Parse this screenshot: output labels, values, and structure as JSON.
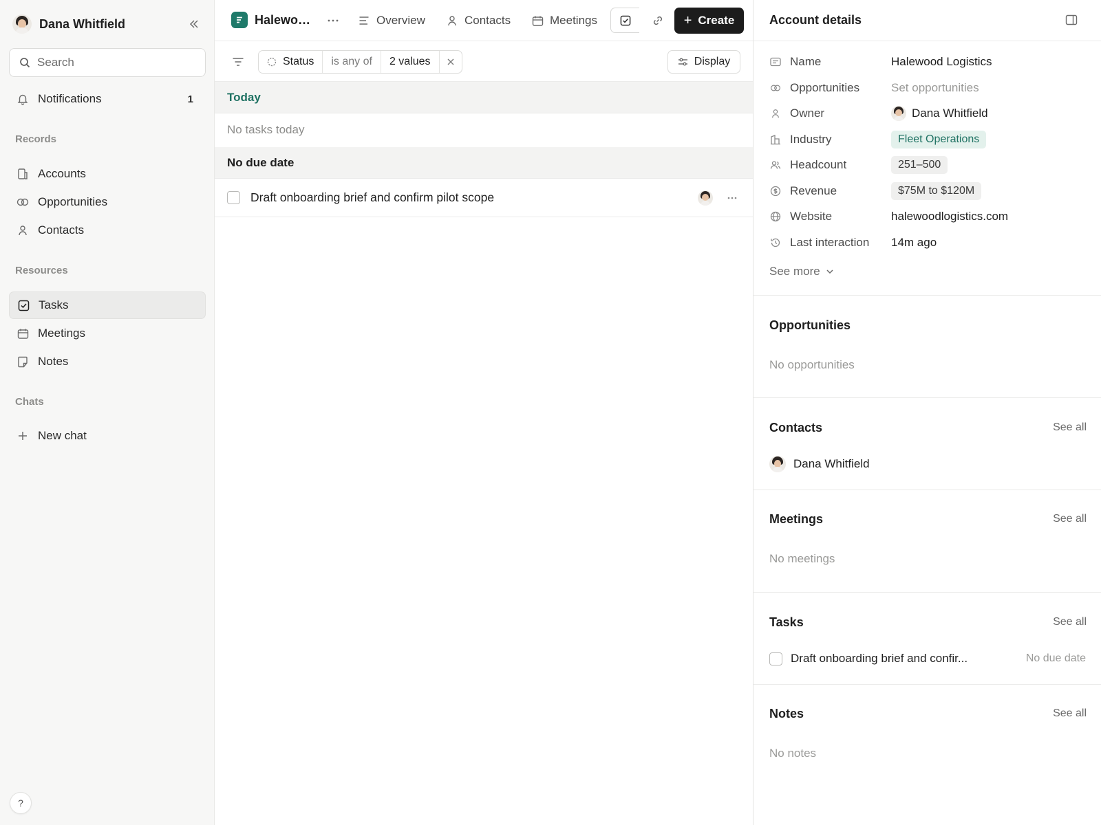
{
  "sidebar": {
    "user_name": "Dana Whitfield",
    "search_placeholder": "Search",
    "notifications": {
      "label": "Notifications",
      "count": "1"
    },
    "records_label": "Records",
    "records": [
      {
        "label": "Accounts",
        "icon": "building-icon"
      },
      {
        "label": "Opportunities",
        "icon": "links-icon"
      },
      {
        "label": "Contacts",
        "icon": "person-icon"
      }
    ],
    "resources_label": "Resources",
    "resources": [
      {
        "label": "Tasks",
        "icon": "checkbox-icon",
        "active": true
      },
      {
        "label": "Meetings",
        "icon": "calendar-icon"
      },
      {
        "label": "Notes",
        "icon": "note-icon"
      }
    ],
    "chats_label": "Chats",
    "new_chat": "New chat",
    "help": "?"
  },
  "header": {
    "account_name": "Halewood Logistics",
    "account_name_display": "Halewoo...",
    "tabs": [
      {
        "label": "Overview",
        "icon": "lines-icon"
      },
      {
        "label": "Contacts",
        "icon": "person-icon"
      },
      {
        "label": "Meetings",
        "icon": "calendar-icon"
      }
    ],
    "create_label": "Create"
  },
  "filter": {
    "field": "Status",
    "operator": "is any of",
    "value": "2 values",
    "remove": "×",
    "display_label": "Display"
  },
  "tasks": {
    "today_label": "Today",
    "today_empty": "No tasks today",
    "nodue_label": "No due date",
    "items": [
      {
        "title": "Draft onboarding brief and confirm pilot scope"
      }
    ]
  },
  "panel": {
    "title": "Account details",
    "properties": {
      "name": {
        "label": "Name",
        "value": "Halewood Logistics"
      },
      "opportunities": {
        "label": "Opportunities",
        "value": "Set opportunities"
      },
      "owner": {
        "label": "Owner",
        "value": "Dana Whitfield"
      },
      "industry": {
        "label": "Industry",
        "value": "Fleet Operations"
      },
      "headcount": {
        "label": "Headcount",
        "value": "251–500"
      },
      "revenue": {
        "label": "Revenue",
        "value": "$75M to $120M"
      },
      "website": {
        "label": "Website",
        "value": "halewoodlogistics.com"
      },
      "last_interaction": {
        "label": "Last interaction",
        "value": "14m ago"
      }
    },
    "see_more": "See more",
    "see_all": "See all",
    "opportunities": {
      "title": "Opportunities",
      "empty": "No opportunities"
    },
    "contacts": {
      "title": "Contacts",
      "items": [
        "Dana Whitfield"
      ]
    },
    "meetings": {
      "title": "Meetings",
      "empty": "No meetings"
    },
    "tasks": {
      "title": "Tasks",
      "items": [
        {
          "title": "Draft onboarding brief and confir...",
          "due": "No due date"
        }
      ]
    },
    "notes": {
      "title": "Notes",
      "empty": "No notes"
    }
  },
  "colors": {
    "accent_green": "#1f7263",
    "create_button": "#1c1c1c",
    "sidebar_bg": "#f7f7f6"
  }
}
